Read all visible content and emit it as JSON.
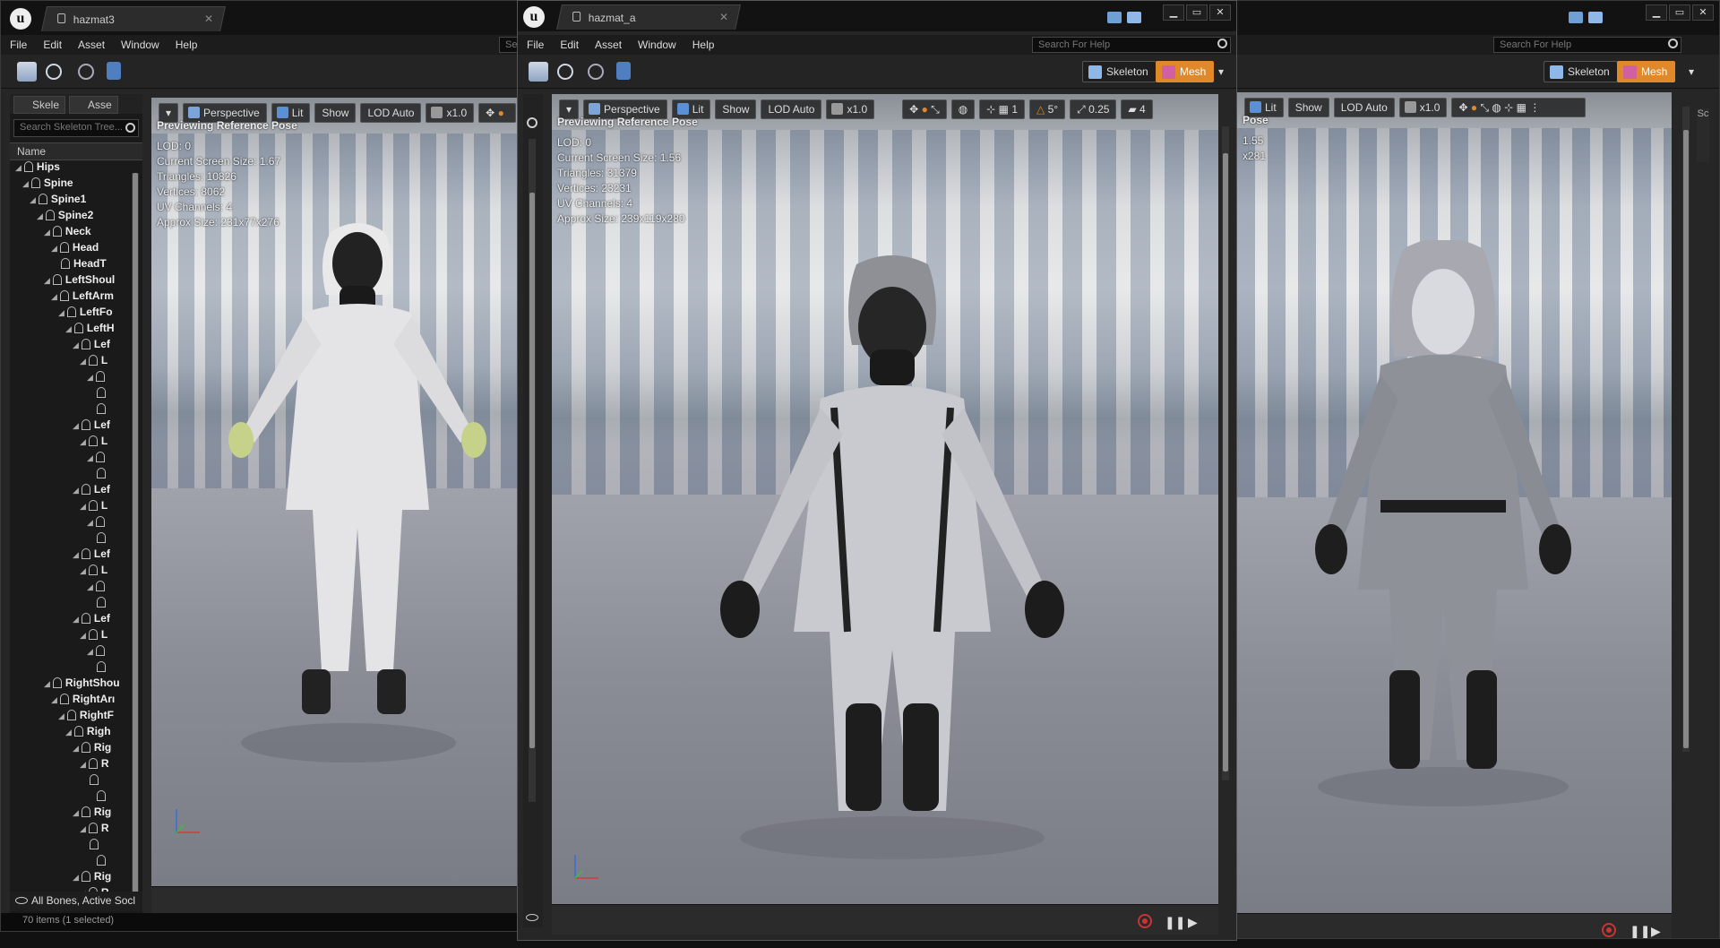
{
  "left_window": {
    "tab_title": "hazmat3",
    "menu": [
      "File",
      "Edit",
      "Asset",
      "Window",
      "Help"
    ],
    "help_search_placeholder": "Se",
    "skeleton_tabs": [
      "Skele",
      "Asse"
    ],
    "skeleton_search_placeholder": "Search Skeleton Tree...",
    "tree_header": "Name",
    "bones": [
      {
        "label": "Hips",
        "depth": 0,
        "expanded": true
      },
      {
        "label": "Spine",
        "depth": 1,
        "expanded": true
      },
      {
        "label": "Spine1",
        "depth": 2,
        "expanded": true
      },
      {
        "label": "Spine2",
        "depth": 3,
        "expanded": true
      },
      {
        "label": "Neck",
        "depth": 4,
        "expanded": true
      },
      {
        "label": "Head",
        "depth": 5,
        "expanded": true
      },
      {
        "label": "HeadT",
        "depth": 6,
        "expanded": false
      },
      {
        "label": "LeftShoul",
        "depth": 4,
        "expanded": true
      },
      {
        "label": "LeftArm",
        "depth": 5,
        "expanded": true
      },
      {
        "label": "LeftFo",
        "depth": 6,
        "expanded": true
      },
      {
        "label": "LeftH",
        "depth": 7,
        "expanded": true
      },
      {
        "label": "Lef",
        "depth": 8,
        "expanded": true
      },
      {
        "label": "L",
        "depth": 9,
        "expanded": true
      },
      {
        "label": "",
        "depth": 10,
        "expanded": true
      },
      {
        "label": "",
        "depth": 11,
        "expanded": false
      },
      {
        "label": "",
        "depth": 11,
        "expanded": false
      },
      {
        "label": "Lef",
        "depth": 8,
        "expanded": true
      },
      {
        "label": "L",
        "depth": 9,
        "expanded": true
      },
      {
        "label": "",
        "depth": 10,
        "expanded": true
      },
      {
        "label": "",
        "depth": 11,
        "expanded": false
      },
      {
        "label": "Lef",
        "depth": 8,
        "expanded": true
      },
      {
        "label": "L",
        "depth": 9,
        "expanded": true
      },
      {
        "label": "",
        "depth": 10,
        "expanded": true
      },
      {
        "label": "",
        "depth": 11,
        "expanded": false
      },
      {
        "label": "Lef",
        "depth": 8,
        "expanded": true
      },
      {
        "label": "L",
        "depth": 9,
        "expanded": true
      },
      {
        "label": "",
        "depth": 10,
        "expanded": true
      },
      {
        "label": "",
        "depth": 11,
        "expanded": false
      },
      {
        "label": "Lef",
        "depth": 8,
        "expanded": true
      },
      {
        "label": "L",
        "depth": 9,
        "expanded": true
      },
      {
        "label": "",
        "depth": 10,
        "expanded": true
      },
      {
        "label": "",
        "depth": 11,
        "expanded": false
      },
      {
        "label": "RightShou",
        "depth": 4,
        "expanded": true
      },
      {
        "label": "RightArı",
        "depth": 5,
        "expanded": true
      },
      {
        "label": "RightF",
        "depth": 6,
        "expanded": true
      },
      {
        "label": "Righ",
        "depth": 7,
        "expanded": true
      },
      {
        "label": "Rig",
        "depth": 8,
        "expanded": true
      },
      {
        "label": "R",
        "depth": 9,
        "expanded": true
      },
      {
        "label": "",
        "depth": 10,
        "expanded": false
      },
      {
        "label": "",
        "depth": 11,
        "expanded": false
      },
      {
        "label": "Rig",
        "depth": 8,
        "expanded": true
      },
      {
        "label": "R",
        "depth": 9,
        "expanded": true
      },
      {
        "label": "",
        "depth": 10,
        "expanded": false
      },
      {
        "label": "",
        "depth": 11,
        "expanded": false
      },
      {
        "label": "Rig",
        "depth": 8,
        "expanded": true
      },
      {
        "label": "R",
        "depth": 9,
        "expanded": true
      }
    ],
    "skeleton_footer": "All Bones, Active Socl",
    "status": "70 items (1 selected)",
    "viewport": {
      "perspective": "Perspective",
      "lit": "Lit",
      "show": "Show",
      "lod": "LOD Auto",
      "speed": "x1.0",
      "pose": "Previewing Reference Pose",
      "info": [
        "LOD: 0",
        "Current Screen Size: 1.67",
        "Triangles: 10826",
        "Vertices: 8062",
        "UV Channels: 4",
        "Approx Size: 231x77x276"
      ]
    }
  },
  "center_window": {
    "tab_title": "hazmat_a",
    "menu": [
      "File",
      "Edit",
      "Asset",
      "Window",
      "Help"
    ],
    "help_search_placeholder": "Search For Help",
    "mode_skeleton": "Skeleton",
    "mode_mesh": "Mesh",
    "viewport": {
      "perspective": "Perspective",
      "lit": "Lit",
      "show": "Show",
      "lod": "LOD Auto",
      "speed": "x1.0",
      "grid_value": "1",
      "angle_snap": "5°",
      "scale_snap": "0.25",
      "camera_speed": "4",
      "pose": "Previewing Reference Pose",
      "info": [
        "LOD: 0",
        "Current Screen Size: 1.56",
        "Triangles: 31379",
        "Vertices: 23231",
        "UV Channels: 4",
        "Approx Size: 239x119x280"
      ]
    }
  },
  "right_window": {
    "help_search_placeholder": "Search For Help",
    "mode_skeleton": "Skeleton",
    "mode_mesh": "Mesh",
    "viewport": {
      "lit": "Lit",
      "show": "Show",
      "lod": "LOD Auto",
      "speed": "x1.0",
      "pose": "Pose",
      "info": [
        "1.55",
        "",
        "",
        "x281"
      ]
    }
  },
  "colors": {
    "accent_orange": "#e0892a",
    "accent_blue": "#5b8fd6",
    "record_red": "#cc3333"
  }
}
